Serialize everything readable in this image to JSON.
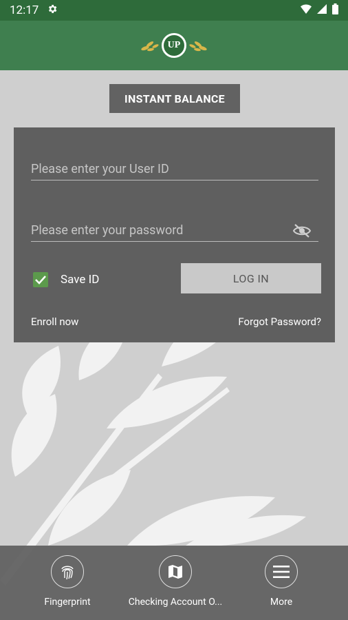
{
  "status_bar": {
    "time": "12:17"
  },
  "header": {
    "logo_text": "UP"
  },
  "instant_balance_label": "INSTANT BALANCE",
  "login": {
    "user_placeholder": "Please enter your User ID",
    "password_placeholder": "Please enter your password",
    "save_id_label": "Save ID",
    "save_id_checked": true,
    "login_label": "LOG IN",
    "enroll_label": "Enroll now",
    "forgot_label": "Forgot Password?"
  },
  "bottom_nav": {
    "items": [
      {
        "label": "Fingerprint",
        "icon": "fingerprint-icon"
      },
      {
        "label": "Checking Account O...",
        "icon": "map-icon"
      },
      {
        "label": "More",
        "icon": "menu-icon"
      }
    ]
  },
  "colors": {
    "status_bar": "#2e6b3a",
    "header": "#3f7f4f",
    "card": "#5f5f5f",
    "checkbox": "#5c9a4c",
    "login_button": "#c9c9c9"
  }
}
